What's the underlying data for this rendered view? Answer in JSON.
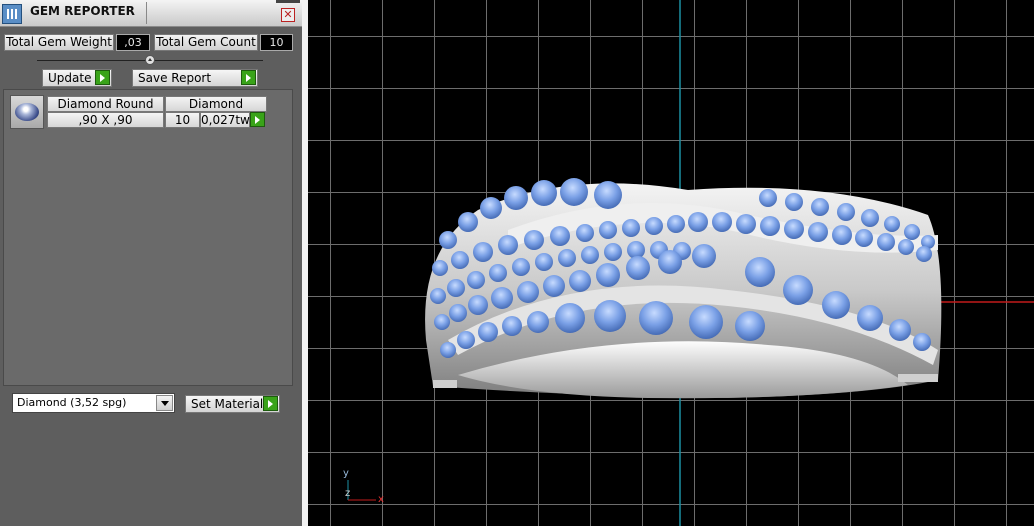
{
  "panel": {
    "title": "GEM REPORTER",
    "total_gem_weight_label": "Total Gem Weight",
    "total_gem_weight_value": ",03",
    "total_gem_count_label": "Total Gem Count",
    "total_gem_count_value": "10",
    "update_label": "Update",
    "save_report_label": "Save Report"
  },
  "gem_row": {
    "shape": "Diamond Round",
    "material": "Diamond",
    "size": ",90 X ,90",
    "count": "10",
    "weight": "0,027tw"
  },
  "material_select": {
    "value": "Diamond     (3,52 spg)",
    "set_label": "Set Material"
  },
  "axes": {
    "y": "y",
    "z": "z",
    "x": "x"
  },
  "colors": {
    "gem_blue": "#7aa0e6",
    "metal": "#d9d9d9",
    "grid": "#6d6d6d",
    "axis_x": "#c21b1b",
    "axis_y": "#1c8fa3"
  }
}
